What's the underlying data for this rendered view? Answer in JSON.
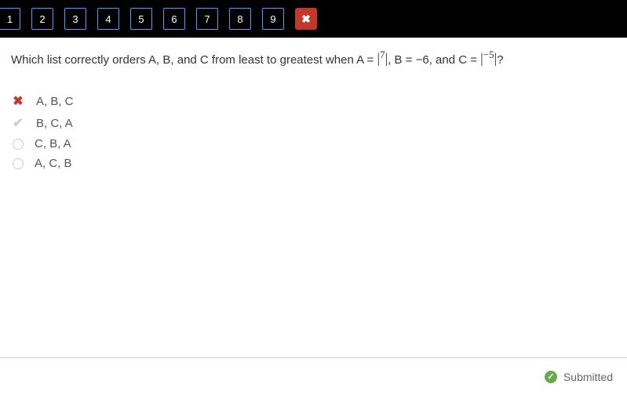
{
  "nav": {
    "items": [
      "1",
      "2",
      "3",
      "4",
      "5",
      "6",
      "7",
      "8",
      "9"
    ]
  },
  "question": {
    "part1": "Which list correctly orders A, B, and C from least to greatest when A = ",
    "abs1": "|7|",
    "part2": ", B =  −6, and  C = ",
    "abs2": "|−5|",
    "part3": "?"
  },
  "options": [
    {
      "label": "A, B, C",
      "state": "wrong"
    },
    {
      "label": "B, C, A",
      "state": "correct"
    },
    {
      "label": "C, B, A",
      "state": "unselected"
    },
    {
      "label": "A, C, B",
      "state": "unselected"
    }
  ],
  "footer": {
    "submitted": "Submitted"
  }
}
